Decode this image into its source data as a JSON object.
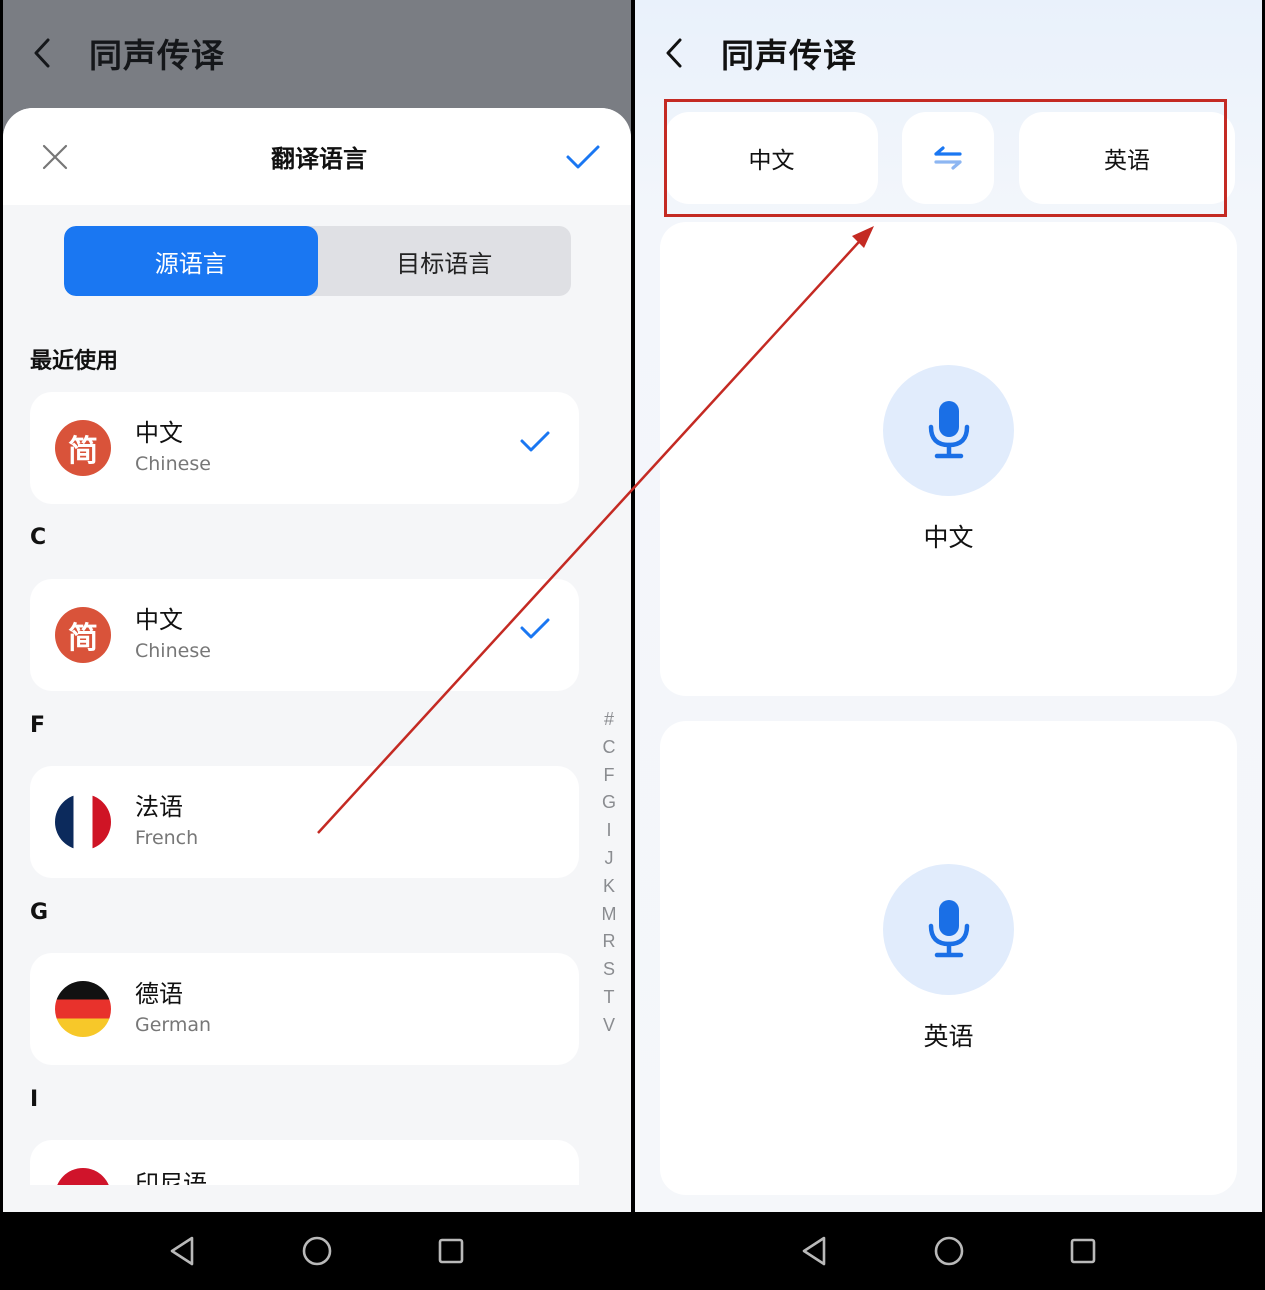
{
  "left": {
    "topbar": {
      "back_icon": "chevron-left-icon",
      "title": "同声传译"
    },
    "sheet": {
      "title": "翻译语言",
      "close_icon": "close-icon",
      "confirm_icon": "check-icon",
      "tabs": [
        {
          "label": "源语言",
          "active": true
        },
        {
          "label": "目标语言",
          "active": false
        }
      ],
      "sections": [
        {
          "header": "最近使用",
          "items": [
            {
              "zh": "中文",
              "en": "Chinese",
              "flag": "简",
              "selected": true
            }
          ]
        },
        {
          "header": "C",
          "items": [
            {
              "zh": "中文",
              "en": "Chinese",
              "flag": "简",
              "selected": true
            }
          ]
        },
        {
          "header": "F",
          "items": [
            {
              "zh": "法语",
              "en": "French",
              "flag": "france-flag",
              "selected": false
            }
          ]
        },
        {
          "header": "G",
          "items": [
            {
              "zh": "德语",
              "en": "German",
              "flag": "germany-flag",
              "selected": false
            }
          ]
        },
        {
          "header": "I",
          "items": [
            {
              "zh": "印尼语",
              "en": "",
              "flag": "indonesia-flag",
              "selected": false
            }
          ]
        }
      ],
      "index_letters": [
        "#",
        "C",
        "F",
        "G",
        "I",
        "J",
        "K",
        "M",
        "R",
        "S",
        "T",
        "V"
      ]
    }
  },
  "right": {
    "topbar": {
      "back_icon": "chevron-left-icon",
      "title": "同声传译"
    },
    "language_bar": {
      "source": "中文",
      "swap_icon": "swap-arrows-icon",
      "target": "英语"
    },
    "speak_panels": [
      {
        "label": "中文",
        "icon": "microphone-icon"
      },
      {
        "label": "英语",
        "icon": "microphone-icon"
      }
    ]
  },
  "nav": {
    "back_icon": "triangle-back-icon",
    "home_icon": "circle-home-icon",
    "recents_icon": "square-recents-icon"
  },
  "colors": {
    "accent": "#1a77f2",
    "annotation": "#c42a23",
    "flag_jian": "#d9533a",
    "mic_bg": "#e1ecfc"
  }
}
